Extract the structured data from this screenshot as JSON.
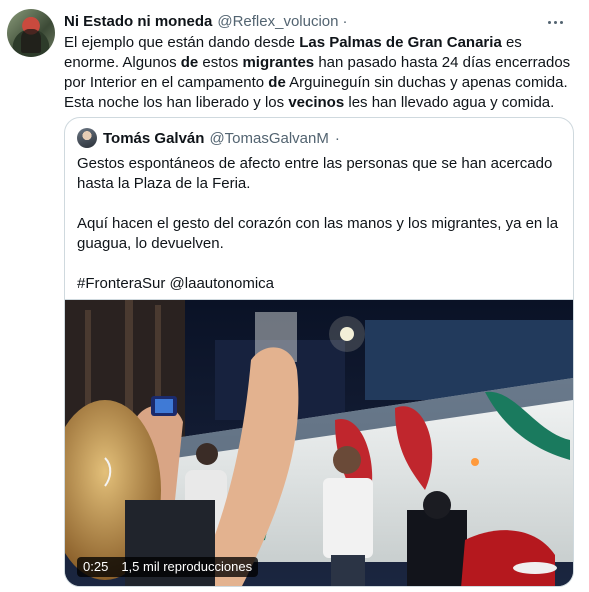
{
  "tweet": {
    "author_name": "Ni Estado ni moneda",
    "author_handle": "@Reflex_volucion",
    "separator": "·",
    "text_segments": [
      {
        "t": "El ejemplo que están dando desde ",
        "b": false
      },
      {
        "t": "Las Palmas de Gran Canaria",
        "b": true
      },
      {
        "t": " es enorme. Algunos ",
        "b": false
      },
      {
        "t": "de",
        "b": true
      },
      {
        "t": " estos ",
        "b": false
      },
      {
        "t": "migrantes",
        "b": true
      },
      {
        "t": " han pasado hasta 24 días encerrados por Interior en el campamento ",
        "b": false
      },
      {
        "t": "de",
        "b": true
      },
      {
        "t": " Arguineguín sin duchas y apenas comida. Esta noche los han liberado y los ",
        "b": false
      },
      {
        "t": "vecinos",
        "b": true
      },
      {
        "t": " les han llevado agua y comida.",
        "b": false
      }
    ]
  },
  "quoted": {
    "author_name": "Tomás Galván",
    "author_handle": "@TomasGalvanM",
    "separator": "·",
    "paragraphs": [
      "Gestos espontáneos de afecto entre las personas que se han acercado hasta la Plaza de la Feria.",
      "Aquí hacen el gesto del corazón con las manos y los migrantes, ya en la guagua, lo devuelven.",
      "#FronteraSur @laautonomica"
    ],
    "video": {
      "duration": "0:25",
      "views": "1,5 mil reproducciones"
    }
  },
  "colors": {
    "text": "#0f1419",
    "secondary": "#536471",
    "border": "#cfd9de"
  }
}
